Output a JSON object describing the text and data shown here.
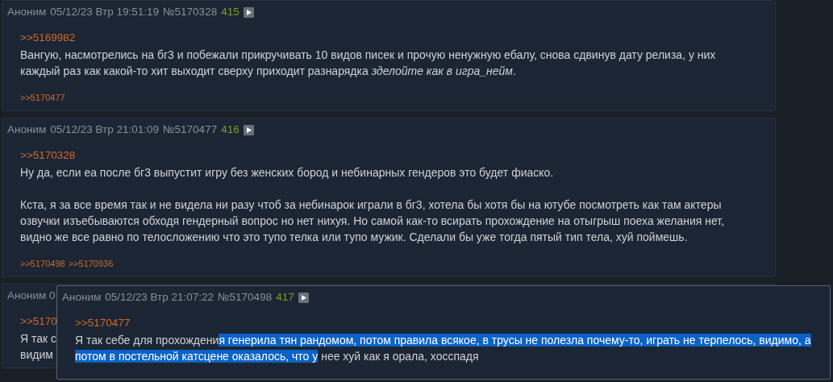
{
  "posts": [
    {
      "author": "Аноним",
      "date": "05/12/23 Втр 19:51:19",
      "number": "№5170328",
      "count": "415",
      "reply_to": ">>5169982",
      "body": [
        "Вангую, насмотрелись на бг3 и побежали прикручивать 10 видов писек и прочую ненужную ебалу, снова сдвинув дату релиза, у них каждый раз как какой-то хит выходит сверху приходит разнарядка *зделойте как в игра_нейм*."
      ],
      "replies": [
        ">>5170477"
      ]
    },
    {
      "author": "Аноним",
      "date": "05/12/23 Втр 21:01:09",
      "number": "№5170477",
      "count": "416",
      "reply_to": ">>5170328",
      "body": [
        "Ну да, если еа после бг3 выпустит игру без женских бород и небинарных гендеров это будет фиаско.",
        "Кста, я за все время так и не видела ни разу чтоб за небинарок играли в бг3, хотела бы хотя бы на ютубе посмотреть как там актеры озвучки изъебываются обходя гендерный вопрос но нет нихуя. Но самой как-то всирать прохождение на отыгрыш поеха желания нет, видно же все равно по телосложению что это тупо телка или тупо мужик. Сделали бы уже тогда пятый тип тела, хуй поймешь."
      ],
      "replies": [
        ">>5170498",
        ">>5170936"
      ]
    }
  ],
  "covered_post": {
    "header": "Аноним 0",
    "reply_to": ">>5170",
    "lines": [
      "Я так с",
      "видим"
    ]
  },
  "preview": {
    "author": "Аноним",
    "date": "05/12/23 Втр 21:07:22",
    "number": "№5170498",
    "count": "417",
    "reply_to": ">>5170477",
    "body": [
      {
        "text": "Я так себе для прохождени",
        "selected": false
      },
      {
        "text": "я генерила тян рандомом, потом правила всякое, в трусы не полезла почему-то, играть не терпелось, видимо, а потом в постельной катсцене оказалось, что у",
        "selected": true
      },
      {
        "text": " нее хуй как я орала, хосспадя",
        "selected": false
      }
    ]
  }
}
